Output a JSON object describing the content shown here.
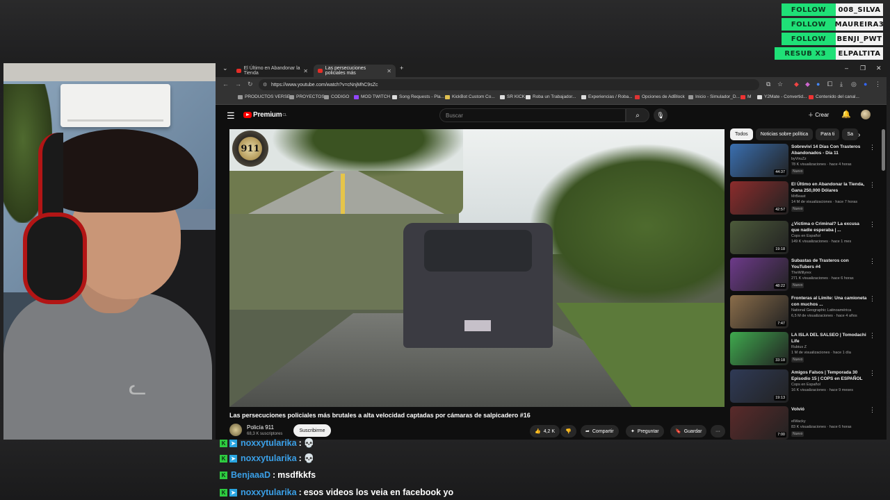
{
  "follow_alerts": [
    {
      "action": "FOLLOW",
      "user": "008_SILVA"
    },
    {
      "action": "FOLLOW",
      "user": "MAUREIRA3"
    },
    {
      "action": "FOLLOW",
      "user": "BENJI_PWT"
    },
    {
      "action": "RESUB X3",
      "user": "ELPALTITA"
    }
  ],
  "browser": {
    "tabs": [
      {
        "label": "El Último en Abandonar la Tienda"
      },
      {
        "label": "Las persecuciones policiales más"
      }
    ],
    "url": "https://www.youtube.com/watch?v=cNnjMhC9sZc",
    "bookmarks": [
      "PRODUCTOS VERSE",
      "PROYECTOS",
      "CODIGO",
      "MOD TWITCH",
      "Song Requests - Pla...",
      "KickBot Custom Co...",
      "SR KICK",
      "Roba un Trabajador...",
      "Experiencias / Roba...",
      "Opciones de AdBlock",
      "Inicio - Simulador_D...",
      "M",
      "Y2Mate - Convertid...",
      "Contenido del canal..."
    ]
  },
  "youtube": {
    "logo": "Premium",
    "logo_region": "CL",
    "search_placeholder": "Buscar",
    "create_label": "Crear",
    "video": {
      "badge_text": "911",
      "title": "Las persecuciones policiales más brutales a alta velocidad captadas por cámaras de salpicadero #16",
      "channel": "Policía 911",
      "subscribers": "68,3 K suscriptores",
      "subscribe_label": "Suscribirme",
      "likes": "4,2 K",
      "share": "Compartir",
      "ask": "Preguntar",
      "save": "Guardar",
      "more": "···"
    },
    "chips": [
      "Todos",
      "Noticias sobre política",
      "Para ti",
      "Sa"
    ],
    "recommendations": [
      {
        "title": "Sobreviví 14 Días Con Trasteros Abandonados - Día 11",
        "channel": "byViruZz",
        "views": "78 K visualizaciones · hace 4 horas",
        "badge": "Nuevo",
        "duration": "44:37",
        "color": "#3a6fb0"
      },
      {
        "title": "El Último en Abandonar la Tienda, Gana 250,000 Dólares",
        "channel": "MrBeast",
        "views": "14 M de visualizaciones · hace 7 horas",
        "badge": "Nuevo",
        "duration": "42:57",
        "color": "#8c2c2c"
      },
      {
        "title": "¿Víctima o Criminal? La excusa que nadie esperaba | ...",
        "channel": "Cops en Español",
        "views": "149 K visualizaciones · hace 1 mes",
        "badge": "",
        "duration": "19:18",
        "color": "#4c5a3a"
      },
      {
        "title": "Subastas de Trasteros con YouTubers #4",
        "channel": "TheWillyrex",
        "views": "271 K visualizaciones · hace 6 horas",
        "badge": "Nuevo",
        "duration": "48:22",
        "color": "#6d3a8a"
      },
      {
        "title": "Fronteras al Límite: Una camioneta con muchos ...",
        "channel": "National Geographic Latinoamérica",
        "views": "6,5 M de visualizaciones · hace 4 años",
        "badge": "",
        "duration": "7:47",
        "color": "#8a6d4a"
      },
      {
        "title": "LA ISLA DEL SALSEO | Tomodachi Life",
        "channel": "Rubius Z",
        "views": "1 M de visualizaciones · hace 1 día",
        "badge": "Nuevo",
        "duration": "33:18",
        "color": "#3fa94e"
      },
      {
        "title": "Amigos Falsos | Temporada 30 Episodio 15 | COPS en ESPAÑOL",
        "channel": "Cops en Español",
        "views": "16 K visualizaciones · hace 9 meses",
        "badge": "",
        "duration": "19:13",
        "color": "#2f3a56"
      },
      {
        "title": "Volvió",
        "channel": "elWacky",
        "views": "83 K visualizaciones · hace 6 horas",
        "badge": "Nuevo",
        "duration": "7:00",
        "color": "#5a2a2a"
      }
    ]
  },
  "chat": [
    {
      "user": "noxxytularika",
      "sep": ":",
      "text": "💀",
      "color": "#3aa0e8",
      "badges": 2
    },
    {
      "user": "noxxytularika",
      "sep": ":",
      "text": "💀",
      "color": "#3aa0e8",
      "badges": 2
    },
    {
      "user": "BenjaaaD",
      "sep": ":",
      "text": "msdfkkfs",
      "color": "#3aa0e8",
      "badges": 1
    },
    {
      "user": "noxxytularika",
      "sep": ":",
      "text": "esos videos los veia en facebook yo",
      "color": "#3aa0e8",
      "badges": 2
    }
  ]
}
